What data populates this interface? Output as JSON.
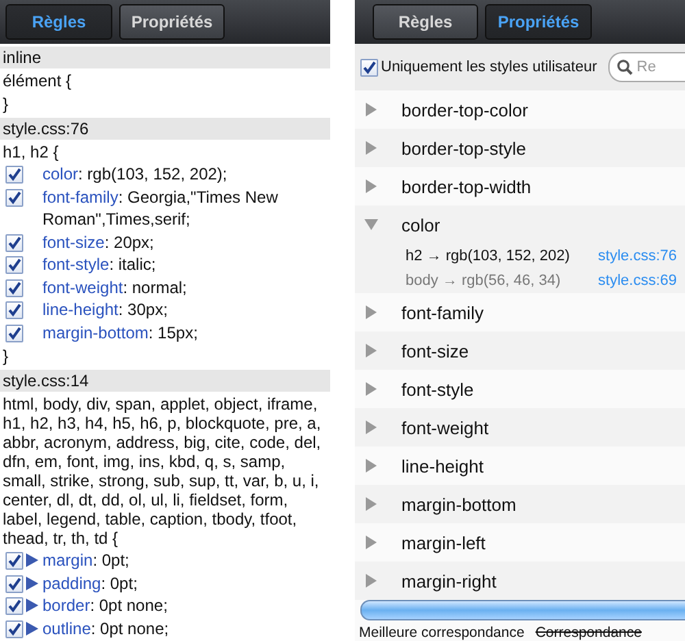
{
  "rules_panel": {
    "tabs": [
      {
        "label": "Règles",
        "selected": true
      },
      {
        "label": "Propriétés",
        "selected": false
      }
    ],
    "sections": [
      {
        "header": "inline",
        "selector": "élément {",
        "closing": "}"
      },
      {
        "header": "style.css:76",
        "selector": "h1, h2 {",
        "closing": "}",
        "declarations": [
          {
            "property": "color",
            "value": ": rgb(103, 152, 202);",
            "enabled": true,
            "expandable": false
          },
          {
            "property": "font-family",
            "value": ": Georgia,\"Times New Roman\",Times,serif;",
            "enabled": true,
            "expandable": false
          },
          {
            "property": "font-size",
            "value": ": 20px;",
            "enabled": true,
            "expandable": false
          },
          {
            "property": "font-style",
            "value": ": italic;",
            "enabled": true,
            "expandable": false
          },
          {
            "property": "font-weight",
            "value": ": normal;",
            "enabled": true,
            "expandable": false
          },
          {
            "property": "line-height",
            "value": ": 30px;",
            "enabled": true,
            "expandable": false
          },
          {
            "property": "margin-bottom",
            "value": ": 15px;",
            "enabled": true,
            "expandable": false
          }
        ]
      },
      {
        "header": "style.css:14",
        "selector": "html, body, div, span, applet, object, iframe, h1, h2, h3, h4, h5, h6, p, blockquote, pre, a, abbr, acronym, address, big, cite, code, del, dfn, em, font, img, ins, kbd, q, s, samp, small, strike, strong, sub, sup, tt, var, b, u, i, center, dl, dt, dd, ol, ul, li, fieldset, form, label, legend, table, caption, tbody, tfoot, thead, tr, th, td {",
        "declarations": [
          {
            "property": "margin",
            "value": ": 0pt;",
            "enabled": true,
            "expandable": true
          },
          {
            "property": "padding",
            "value": ": 0pt;",
            "enabled": true,
            "expandable": true
          },
          {
            "property": "border",
            "value": ": 0pt none;",
            "enabled": true,
            "expandable": true
          },
          {
            "property": "outline",
            "value": ": 0pt none;",
            "enabled": true,
            "expandable": true
          }
        ]
      }
    ]
  },
  "properties_panel": {
    "tabs": [
      {
        "label": "Règles",
        "selected": false
      },
      {
        "label": "Propriétés",
        "selected": true
      }
    ],
    "user_styles_only": {
      "label": "Uniquement les styles utilisateur",
      "checked": true
    },
    "search": {
      "placeholder": "Re"
    },
    "properties": [
      {
        "name": "border-top-color",
        "expanded": false
      },
      {
        "name": "border-top-style",
        "expanded": false
      },
      {
        "name": "border-top-width",
        "expanded": false
      },
      {
        "name": "color",
        "expanded": true,
        "matches": [
          {
            "rule": "h2 → rgb(103, 152, 202)",
            "source": "style.css:76",
            "overridden": false
          },
          {
            "rule": "body → rgb(56, 46, 34)",
            "source": "style.css:69",
            "overridden": true
          }
        ]
      },
      {
        "name": "font-family",
        "expanded": false
      },
      {
        "name": "font-size",
        "expanded": false
      },
      {
        "name": "font-style",
        "expanded": false
      },
      {
        "name": "font-weight",
        "expanded": false
      },
      {
        "name": "line-height",
        "expanded": false
      },
      {
        "name": "margin-bottom",
        "expanded": false
      },
      {
        "name": "margin-left",
        "expanded": false
      },
      {
        "name": "margin-right",
        "expanded": false
      }
    ],
    "legend": [
      {
        "label": "Meilleure correspondance",
        "struck": false
      },
      {
        "label": "Correspondance",
        "struck": true
      }
    ]
  }
}
